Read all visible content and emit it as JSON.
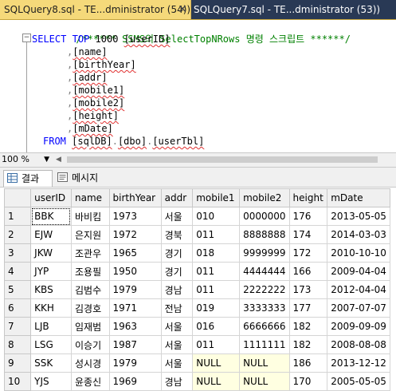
{
  "tabs": [
    {
      "label": "SQLQuery8.sql - TE...dministrator (54))",
      "close": "✕"
    },
    {
      "label": "SQLQuery7.sql - TE...dministrator (53))"
    }
  ],
  "editor": {
    "comment": "/****** SSMS의 SelectTopNRows 명령 스크립트 ******/",
    "select_kw": "SELECT",
    "top_kw": "TOP",
    "top_n": "1000",
    "columns": [
      "[userID]",
      "[name]",
      "[birthYear]",
      "[addr]",
      "[mobile1]",
      "[mobile2]",
      "[height]",
      "[mDate]"
    ],
    "from_kw": "FROM",
    "from_db": "[sqlDB]",
    "from_schema": "[dbo]",
    "from_table": "[userTbl]"
  },
  "zoom": {
    "value": "100 %"
  },
  "result_tabs": [
    {
      "label": "결과",
      "icon": "grid-icon"
    },
    {
      "label": "메시지",
      "icon": "message-icon"
    }
  ],
  "grid": {
    "headers": [
      "userID",
      "name",
      "birthYear",
      "addr",
      "mobile1",
      "mobile2",
      "height",
      "mDate"
    ],
    "rows": [
      [
        "1",
        "BBK",
        "바비킴",
        "1973",
        "서울",
        "010",
        "0000000",
        "176",
        "2013-05-05"
      ],
      [
        "2",
        "EJW",
        "은지원",
        "1972",
        "경북",
        "011",
        "8888888",
        "174",
        "2014-03-03"
      ],
      [
        "3",
        "JKW",
        "조관우",
        "1965",
        "경기",
        "018",
        "9999999",
        "172",
        "2010-10-10"
      ],
      [
        "4",
        "JYP",
        "조용필",
        "1950",
        "경기",
        "011",
        "4444444",
        "166",
        "2009-04-04"
      ],
      [
        "5",
        "KBS",
        "김범수",
        "1979",
        "경남",
        "011",
        "2222222",
        "173",
        "2012-04-04"
      ],
      [
        "6",
        "KKH",
        "김경호",
        "1971",
        "전남",
        "019",
        "3333333",
        "177",
        "2007-07-07"
      ],
      [
        "7",
        "LJB",
        "임재범",
        "1963",
        "서울",
        "016",
        "6666666",
        "182",
        "2009-09-09"
      ],
      [
        "8",
        "LSG",
        "이승기",
        "1987",
        "서울",
        "011",
        "1111111",
        "182",
        "2008-08-08"
      ],
      [
        "9",
        "SSK",
        "성시경",
        "1979",
        "서울",
        "NULL",
        "NULL",
        "186",
        "2013-12-12"
      ],
      [
        "10",
        "YJS",
        "윤종신",
        "1969",
        "경남",
        "NULL",
        "NULL",
        "170",
        "2005-05-05"
      ]
    ]
  },
  "colors": {
    "active_tab": "#f5d97a",
    "tabbar": "#293955",
    "keyword": "#0000ff",
    "comment": "#008000",
    "null_cell": "#ffffe1"
  }
}
